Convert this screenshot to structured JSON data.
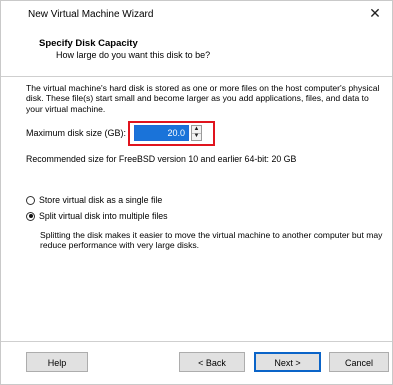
{
  "window": {
    "title": "New Virtual Machine Wizard",
    "close_glyph": "✕"
  },
  "header": {
    "title": "Specify Disk Capacity",
    "subtitle": "How large do you want this disk to be?"
  },
  "body": {
    "description": "The virtual machine's hard disk is stored as one or more files on the host computer's physical disk. These file(s) start small and become larger as you add applications, files, and data to your virtual machine.",
    "max_size_label": "Maximum disk size (GB):",
    "max_size_value": "20.0",
    "recommended": "Recommended size for FreeBSD version 10 and earlier 64-bit: 20 GB"
  },
  "options": {
    "single_file_label": "Store virtual disk as a single file",
    "multi_file_label": "Split virtual disk into multiple files",
    "selected": "multi",
    "multi_description": "Splitting the disk makes it easier to move the virtual machine to another computer but may reduce performance with very large disks."
  },
  "buttons": {
    "help": "Help",
    "back": "< Back",
    "next": "Next >",
    "cancel": "Cancel"
  },
  "colors": {
    "highlight_border": "#e0141e",
    "selection_blue": "#1a73d9",
    "default_button_border": "#0a64c8"
  }
}
